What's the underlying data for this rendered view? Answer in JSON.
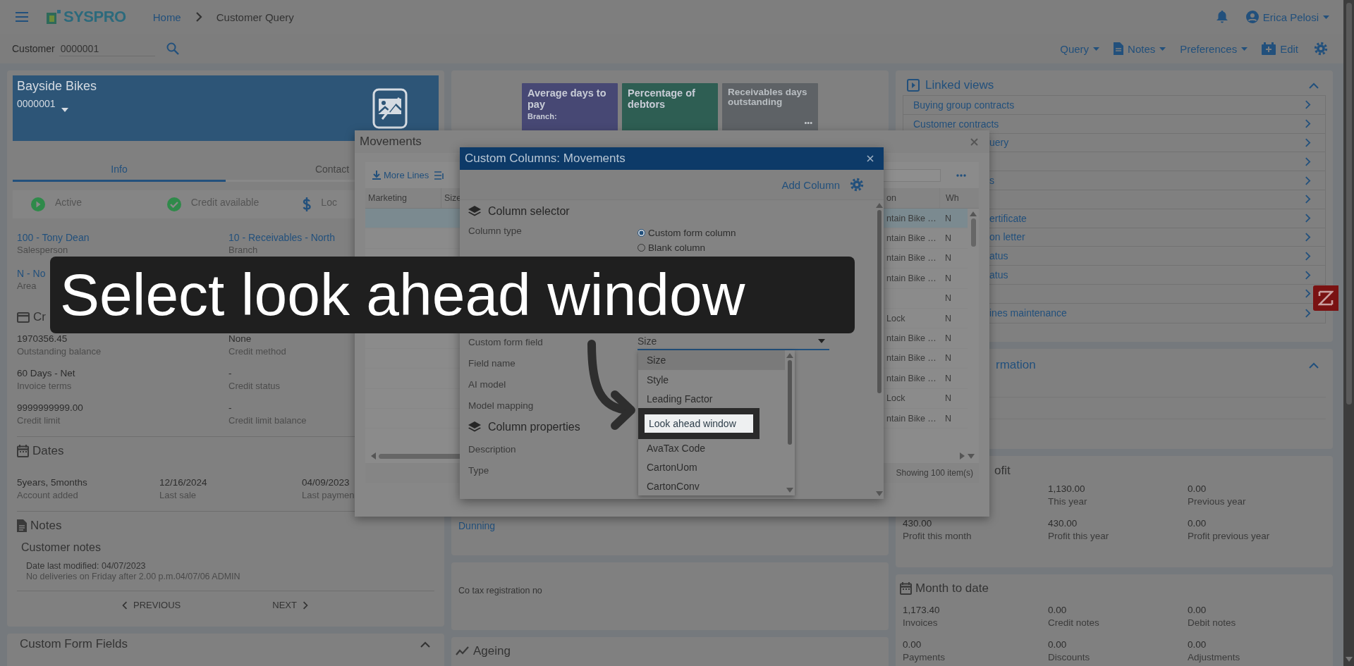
{
  "header": {
    "brand": "SYSPRO",
    "breadcrumb": [
      {
        "label": "Home",
        "kind": "link"
      },
      {
        "label": "Customer Query",
        "kind": "current"
      }
    ],
    "user": "Erica Pelosi"
  },
  "customer_bar": {
    "label": "Customer",
    "value": "0000001",
    "actions": [
      {
        "label": "Query",
        "kind": "menu"
      },
      {
        "label": "Notes",
        "kind": "notes"
      },
      {
        "label": "Preferences",
        "kind": "menu"
      },
      {
        "label": "Edit",
        "kind": "edit"
      }
    ]
  },
  "customer": {
    "name": "Bayside Bikes",
    "code": "0000001",
    "tabs": [
      {
        "label": "Info",
        "selected": true
      },
      {
        "label": "Contact",
        "selected": false
      }
    ],
    "statuses": [
      {
        "label": "Active",
        "kind": "active"
      },
      {
        "label": "Credit available",
        "kind": "check"
      },
      {
        "label": "Loc",
        "kind": "dollar"
      }
    ],
    "fields": [
      {
        "value": "100 - Tony Dean",
        "label": "Salesperson"
      },
      {
        "value": "10 - Receivables - North",
        "label": "Branch"
      },
      {
        "value": "N - No",
        "label": "Area"
      }
    ],
    "credit": {
      "title": "Cr",
      "fields": [
        {
          "value": "1970356.45",
          "label": "Outstanding balance"
        },
        {
          "value": "None",
          "label": "Credit method"
        },
        {
          "value": "60 Days - Net",
          "label": "Invoice terms"
        },
        {
          "value": "-",
          "label": "Credit status"
        },
        {
          "value": "9999999999.00",
          "label": "Credit limit"
        },
        {
          "value": "-",
          "label": "Credit limit balance"
        }
      ]
    },
    "dates": {
      "title": "Dates",
      "fields": [
        {
          "value": "5years, 5months",
          "label": "Account added"
        },
        {
          "value": "12/16/2024",
          "label": "Last sale"
        },
        {
          "value": "04/09/2023",
          "label": "Last paymen"
        }
      ]
    },
    "notes": {
      "title": "Notes",
      "subtitle": "Customer notes",
      "modified": "Date last modified: 04/07/2023",
      "text": "No deliveries on Friday after 2.00 p.m.04/07/06 ADMIN"
    },
    "pager": {
      "previous": "PREVIOUS",
      "next": "NEXT"
    }
  },
  "custom_form_fields": {
    "title": "Custom Form Fields",
    "expanded": true
  },
  "tiles": [
    {
      "title": "Average days to pay",
      "subtitle": "Branch:",
      "color": "#474874"
    },
    {
      "title": "Percentage of debtors",
      "color": "#2e5e53"
    },
    {
      "title": "Receivables days outstanding",
      "color": "#5e6266",
      "more": "•••"
    }
  ],
  "dunning": "Dunning",
  "tax_label": "Co tax registration no",
  "ageing": "Ageing",
  "linked_views": {
    "title": "Linked views",
    "expanded": true,
    "items": [
      {
        "label": "Buying group contracts",
        "kind": "full"
      },
      {
        "label": "Customer contracts",
        "kind": "full"
      },
      {
        "label": "uery",
        "kind": "partial"
      },
      {
        "kind": "covered"
      },
      {
        "label": "s",
        "kind": "partial"
      },
      {
        "kind": "covered"
      },
      {
        "label": "ertificate",
        "kind": "partial"
      },
      {
        "label": "on letter",
        "kind": "partial"
      },
      {
        "label": "atus",
        "kind": "partial"
      },
      {
        "label": "atus",
        "kind": "partial"
      },
      {
        "kind": "covered"
      },
      {
        "label": "ines maintenance",
        "kind": "partial"
      }
    ]
  },
  "information": {
    "title": "rmation",
    "expanded": true
  },
  "profit": {
    "title": "ofit",
    "fields": [
      {
        "kind": "covered"
      },
      {
        "value": "1,130.00",
        "label": "This year",
        "kind": "full"
      },
      {
        "value": "0.00",
        "label": "Previous year",
        "kind": "full"
      },
      {
        "value": "430.00",
        "label": "Profit this month",
        "kind": "full"
      },
      {
        "value": "430.00",
        "label": "Profit this year",
        "kind": "full"
      },
      {
        "value": "0.00",
        "label": "Profit previous year",
        "kind": "full"
      }
    ]
  },
  "month_to_date": {
    "title": "Month to date",
    "fields": [
      {
        "value": "1,173.40",
        "label": "Invoices"
      },
      {
        "value": "0.00",
        "label": "Credit notes"
      },
      {
        "value": "0.00",
        "label": "Debit notes"
      },
      {
        "value": "0.00",
        "label": "Payments"
      },
      {
        "value": "0.00",
        "label": "Discounts"
      },
      {
        "value": "0.00",
        "label": "Adjustments"
      }
    ]
  },
  "movements": {
    "title": "Movements",
    "more_lines": "More Lines",
    "columns": [
      "Marketing",
      "Size"
    ],
    "right_columns": [
      "on",
      "Wh"
    ],
    "rows": [
      {
        "description": "ntain Bike …",
        "wh": "N",
        "selected": true
      },
      {
        "description": "ntain Bike …",
        "wh": "N",
        "selected": false
      },
      {
        "description": "ntain Bike …",
        "wh": "N",
        "selected": false
      },
      {
        "description": "ntain Bike …",
        "wh": "N",
        "selected": false
      },
      {
        "wh": "N",
        "selected": false
      },
      {
        "description": "Lock",
        "wh": "N",
        "selected": false
      },
      {
        "description": "ntain Bike …",
        "wh": "N",
        "selected": false
      },
      {
        "description": "ntain Bike …",
        "wh": "N",
        "selected": false
      },
      {
        "description": "ntain Bike …",
        "wh": "N",
        "selected": false
      },
      {
        "description": "Lock",
        "wh": "N",
        "selected": false
      },
      {
        "description": "ntain Bike …",
        "wh": "N",
        "selected": false
      }
    ],
    "footer": "Showing 100 item(s)"
  },
  "custom_columns": {
    "title": "Custom Columns: Movements",
    "add": "Add Column",
    "selector_title": "Column selector",
    "column_type": {
      "label": "Column type",
      "options": [
        {
          "label": "Custom form column",
          "selected": true
        },
        {
          "label": "Blank column",
          "selected": false
        }
      ]
    },
    "fields": [
      {
        "label": "Custom form field",
        "value": "Size",
        "kind": "select",
        "focused": true
      },
      {
        "label": "Field name",
        "kind": "text"
      },
      {
        "label": "AI model",
        "kind": "text"
      },
      {
        "label": "Model mapping",
        "kind": "text"
      }
    ],
    "properties_title": "Column properties",
    "properties": [
      {
        "label": "Description"
      },
      {
        "label": "Type"
      }
    ],
    "dropdown": [
      {
        "label": "Size",
        "highlighted": true,
        "selected": false
      },
      {
        "label": "Style",
        "highlighted": false,
        "selected": false
      },
      {
        "label": "Leading Factor",
        "highlighted": false,
        "selected": false
      },
      {
        "label": "Look ahead window",
        "highlighted": true,
        "selected": true
      },
      {
        "label": "AvaTax Code",
        "highlighted": false,
        "selected": false
      },
      {
        "label": "CartonUom",
        "highlighted": false,
        "selected": false
      },
      {
        "label": "CartonConv",
        "highlighted": false,
        "selected": false
      }
    ]
  },
  "caption": "Select look ahead window"
}
